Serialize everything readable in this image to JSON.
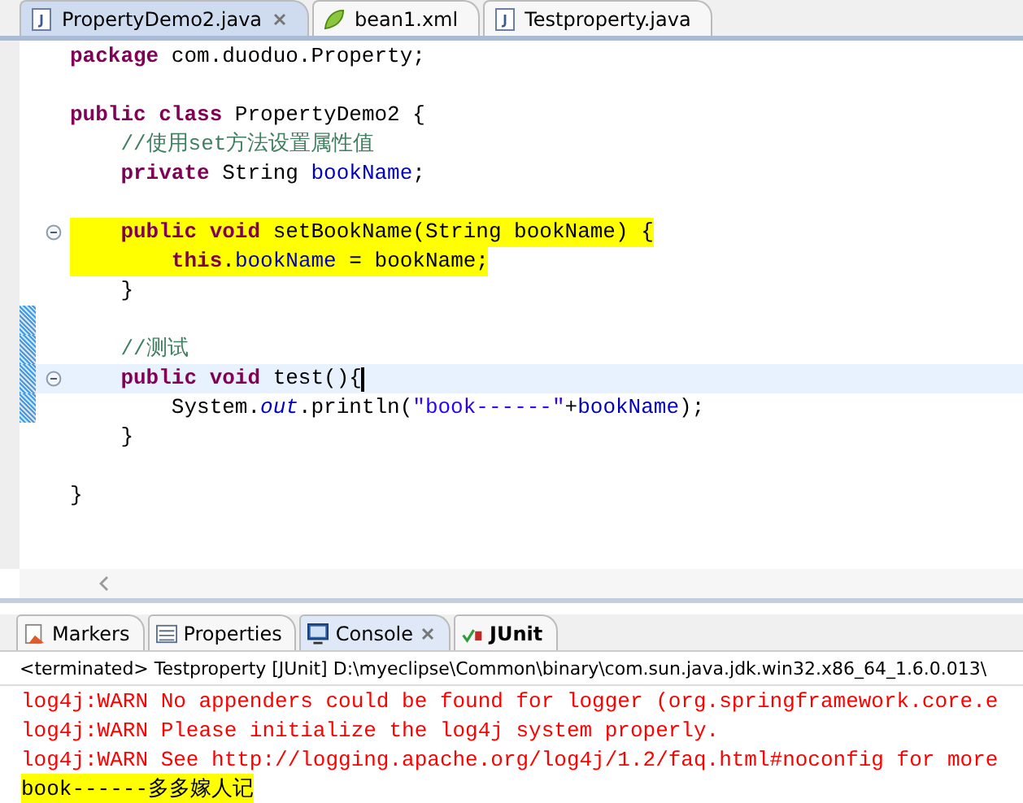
{
  "editor_tabs": [
    {
      "label": "PropertyDemo2.java",
      "kind": "java",
      "selected": true,
      "closable": true
    },
    {
      "label": "bean1.xml",
      "kind": "xml",
      "selected": false,
      "closable": false
    },
    {
      "label": "Testproperty.java",
      "kind": "java",
      "selected": false,
      "closable": false
    }
  ],
  "code_lines": [
    {
      "kind": "code",
      "tokens": [
        {
          "kind": "kw",
          "text": "package"
        },
        {
          "kind": "plain",
          "text": " com.duoduo.Property;"
        }
      ]
    },
    {
      "kind": "blank"
    },
    {
      "kind": "code",
      "tokens": [
        {
          "kind": "kw",
          "text": "public"
        },
        {
          "kind": "kw",
          "text": " class"
        },
        {
          "kind": "plain",
          "text": " PropertyDemo2 {"
        }
      ]
    },
    {
      "kind": "code",
      "tokens": [
        {
          "kind": "comment",
          "text": "    //使用set方法设置属性值"
        }
      ]
    },
    {
      "kind": "code",
      "tokens": [
        {
          "kind": "kw",
          "text": "    private"
        },
        {
          "kind": "plain",
          "text": " String "
        },
        {
          "kind": "field",
          "text": "bookName"
        },
        {
          "kind": "plain",
          "text": ";"
        }
      ]
    },
    {
      "kind": "blank"
    },
    {
      "kind": "code",
      "fold": true,
      "marked": true,
      "tokens": [
        {
          "kind": "kw",
          "text": "    public"
        },
        {
          "kind": "kw",
          "text": " void"
        },
        {
          "kind": "plain",
          "text": " setBookName(String bookName) {"
        }
      ]
    },
    {
      "kind": "code",
      "marked": true,
      "tokens": [
        {
          "kind": "kw",
          "text": "        this"
        },
        {
          "kind": "plain",
          "text": "."
        },
        {
          "kind": "field",
          "text": "bookName"
        },
        {
          "kind": "plain",
          "text": " = bookName;"
        }
      ]
    },
    {
      "kind": "code",
      "tokens": [
        {
          "kind": "plain",
          "text": "    }"
        }
      ]
    },
    {
      "kind": "blank",
      "changed": true
    },
    {
      "kind": "code",
      "changed": true,
      "tokens": [
        {
          "kind": "comment",
          "text": "    //测试"
        }
      ]
    },
    {
      "kind": "code",
      "fold": true,
      "current": true,
      "changed": true,
      "tokens": [
        {
          "kind": "kw",
          "text": "    public"
        },
        {
          "kind": "kw",
          "text": " void"
        },
        {
          "kind": "plain",
          "text": " test(){"
        }
      ]
    },
    {
      "kind": "code",
      "changed": true,
      "tokens": [
        {
          "kind": "plain",
          "text": "        System."
        },
        {
          "kind": "static",
          "text": "out"
        },
        {
          "kind": "plain",
          "text": ".println("
        },
        {
          "kind": "string",
          "text": "\"book------\""
        },
        {
          "kind": "plain",
          "text": "+"
        },
        {
          "kind": "field",
          "text": "bookName"
        },
        {
          "kind": "plain",
          "text": ");"
        }
      ]
    },
    {
      "kind": "code",
      "tokens": [
        {
          "kind": "plain",
          "text": "    }"
        }
      ]
    },
    {
      "kind": "blank"
    },
    {
      "kind": "code",
      "tokens": [
        {
          "kind": "plain",
          "text": "}"
        }
      ]
    }
  ],
  "panel_tabs": [
    {
      "label": "Markers",
      "kind": "markers",
      "selected": false,
      "closable": false,
      "bold": false
    },
    {
      "label": "Properties",
      "kind": "properties",
      "selected": false,
      "closable": false,
      "bold": false
    },
    {
      "label": "Console",
      "kind": "console",
      "selected": true,
      "closable": true,
      "bold": false
    },
    {
      "label": "JUnit",
      "kind": "junit",
      "selected": false,
      "closable": false,
      "bold": true
    }
  ],
  "console": {
    "header": "<terminated> Testproperty [JUnit] D:\\myeclipse\\Common\\binary\\com.sun.java.jdk.win32.x86_64_1.6.0.013\\",
    "lines": [
      {
        "kind": "error",
        "text": "log4j:WARN No appenders could be found for logger (org.springframework.core.e",
        "marked": false
      },
      {
        "kind": "error",
        "text": "log4j:WARN Please initialize the log4j system properly.",
        "marked": false
      },
      {
        "kind": "error",
        "text": "log4j:WARN See http://logging.apache.org/log4j/1.2/faq.html#noconfig for more",
        "marked": false
      },
      {
        "kind": "output",
        "text": "book------多多嫁人记",
        "marked": true
      }
    ]
  }
}
